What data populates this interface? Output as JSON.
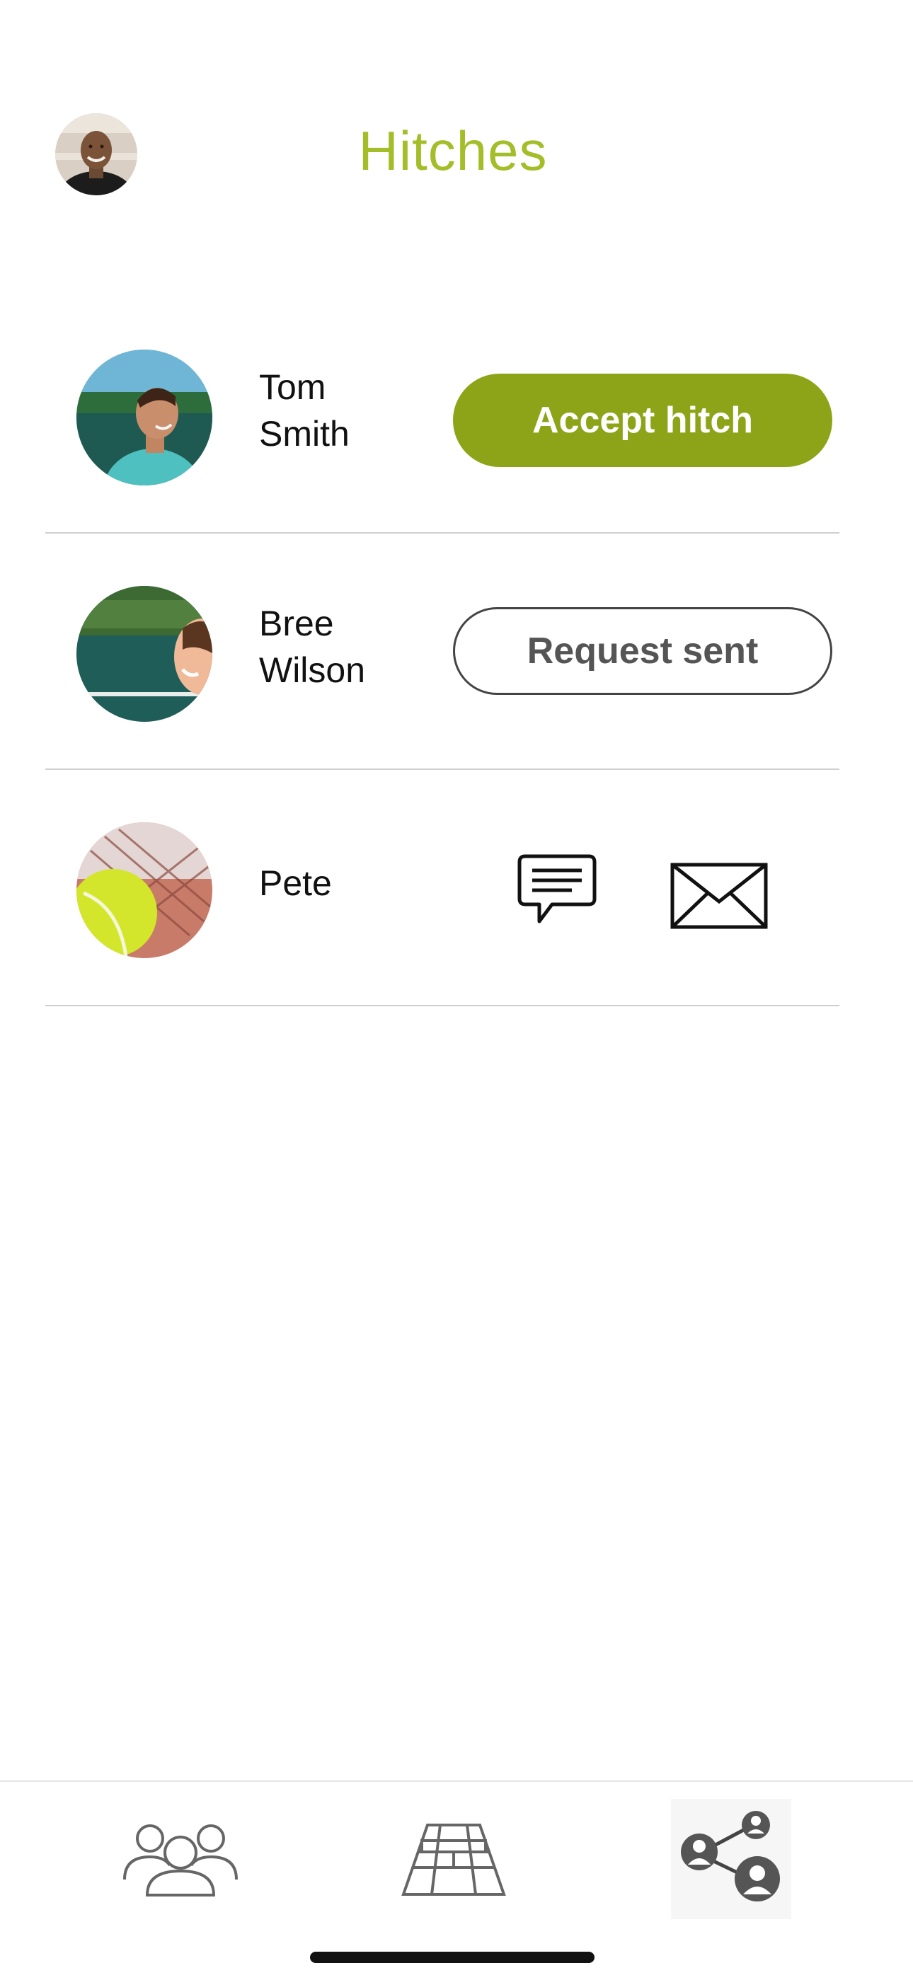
{
  "header": {
    "title": "Hitches",
    "title_color": "#a4be2a",
    "profile_avatar_icon": "user-avatar"
  },
  "rows": [
    {
      "first_name": "Tom",
      "last_name": "Smith",
      "action": "accept",
      "action_label": "Accept hitch",
      "action_color": "#8ea418"
    },
    {
      "first_name": "Bree",
      "last_name": "Wilson",
      "action": "request_sent",
      "action_label": "Request sent"
    },
    {
      "first_name": "Pete",
      "last_name": "",
      "action": "connected",
      "action_icons": [
        "chat-bubble-icon",
        "envelope-icon"
      ]
    }
  ],
  "bottom_nav": {
    "items": [
      {
        "icon": "group-icon"
      },
      {
        "icon": "tennis-court-icon"
      },
      {
        "icon": "network-icon",
        "active": true
      }
    ]
  }
}
